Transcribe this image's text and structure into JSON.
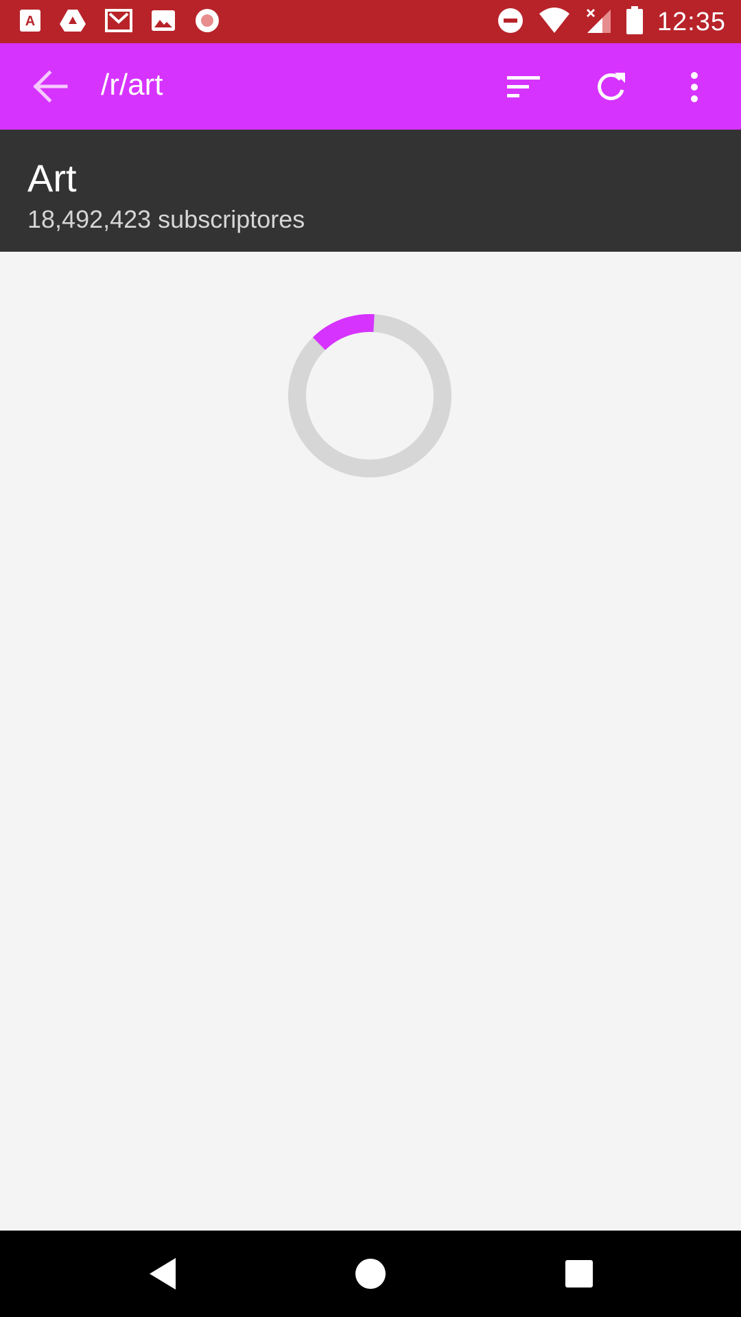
{
  "status_bar": {
    "time": "12:35",
    "left_icons": [
      "adobe-acrobat-icon",
      "google-drive-icon",
      "gmail-icon",
      "photos-icon",
      "record-icon"
    ],
    "right_icons": [
      "do-not-disturb-icon",
      "wifi-icon",
      "signal-no-data-icon",
      "battery-icon"
    ]
  },
  "app_bar": {
    "title": "/r/art",
    "color": "#d633ff",
    "actions": [
      "sort-icon",
      "refresh-icon",
      "more-vert-icon"
    ]
  },
  "subreddit": {
    "name": "Art",
    "subscribers": "18,492,423 subscriptores"
  },
  "loading": {
    "indicator": "circular-progress",
    "accent": "#d633ff",
    "track": "#d6d6d6"
  },
  "nav_bar": {
    "buttons": [
      "back-triangle-icon",
      "home-circle-icon",
      "recents-square-icon"
    ]
  }
}
